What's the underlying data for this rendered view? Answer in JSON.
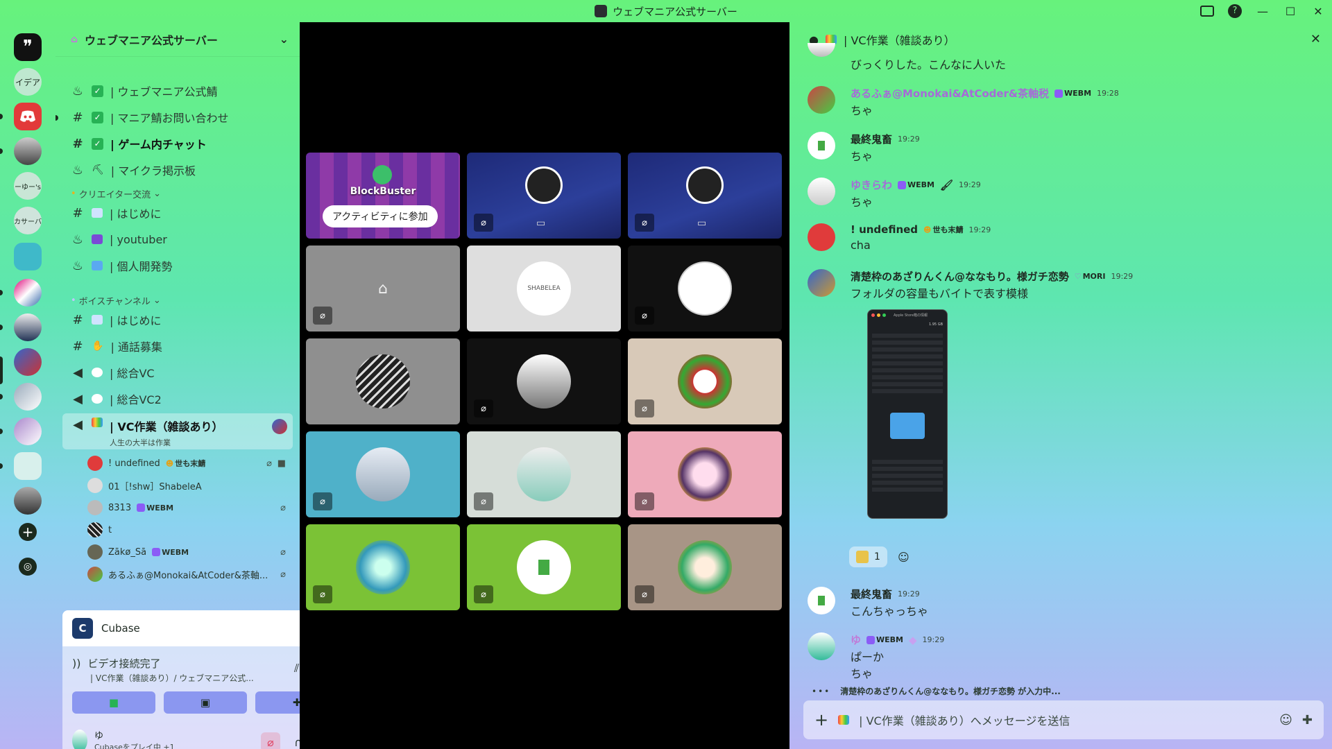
{
  "window": {
    "title": "ウェブマニア公式サーバー"
  },
  "rail": {
    "items": [
      {
        "label": "❞",
        "bg": "#111"
      },
      {
        "label": "イデア",
        "bg": "#bfe8d0"
      },
      {
        "label": "discord",
        "bg": "#e23a3a"
      },
      {
        "label": "",
        "bg": "#9aa"
      },
      {
        "label": "ーゆー's",
        "bg": "#c9e6d6"
      },
      {
        "label": "カサーバ",
        "bg": "#cfe4dc"
      },
      {
        "label": "",
        "bg": "#3fb9c9"
      },
      {
        "label": "",
        "bg": "#d07"
      },
      {
        "label": "",
        "bg": "#36a"
      },
      {
        "label": "",
        "bg": "#55c"
      },
      {
        "label": "",
        "bg": "#7a8"
      },
      {
        "label": "",
        "bg": "#a8b"
      },
      {
        "label": "",
        "bg": "#cfe"
      },
      {
        "label": "",
        "bg": "#333"
      }
    ]
  },
  "sidebar": {
    "server_name": "ウェブマニア公式サーバー",
    "channels": [
      {
        "sym": "♨",
        "label": "| ウェブマニア公式鯖"
      },
      {
        "sym": "#",
        "label": "| マニア鯖お問い合わせ"
      },
      {
        "sym": "#",
        "label": "| ゲーム内チャット"
      },
      {
        "sym": "♨",
        "label": "| マイクラ掲示板"
      }
    ],
    "cat_creator": "クリエイター交流",
    "creator_channels": [
      {
        "sym": "#",
        "label": "| はじめに"
      },
      {
        "sym": "♨",
        "label": "| youtuber"
      },
      {
        "sym": "♨",
        "label": "| 個人開発勢"
      }
    ],
    "cat_voice": "ボイスチャンネル",
    "voice_channels": [
      {
        "sym": "#",
        "label": "| はじめに"
      },
      {
        "sym": "#",
        "label": "| 通話募集"
      },
      {
        "sym": "🔊",
        "label": "| 総合VC"
      },
      {
        "sym": "🔊",
        "label": "| 総合VC2"
      }
    ],
    "active_vc": {
      "label": "| VC作業（雑談あり）",
      "status": "人生の大半は作業"
    },
    "members": [
      {
        "name": "! undefined",
        "tag": "世も末鯖",
        "color": "#e03b3b"
      },
      {
        "name": "01［!shw］ShabeleA",
        "tag": "",
        "color": "#ddd"
      },
      {
        "name": "8313",
        "tag": "WEBM",
        "color": "#bbb"
      },
      {
        "name": "t",
        "tag": "",
        "color": "#222"
      },
      {
        "name": "Zākø_Sā",
        "tag": "WEBM",
        "color": "#665"
      },
      {
        "name": "あるふぁ@Monokai&AtCoder&茶軸...",
        "tag": "",
        "color": "#c44"
      }
    ]
  },
  "panel": {
    "app_name": "Cubase",
    "conn_title": "ビデオ接続完了",
    "conn_sub": "| VC作業（雑談あり）/ ウェブマニア公式...",
    "user_name": "ゆ",
    "user_status": "Cubaseをプレイ中 +1"
  },
  "stage": {
    "activity_title": "BlockBuster",
    "activity_join": "アクティビティに参加",
    "shabelea_text": "SHABELEA"
  },
  "chat": {
    "channel": "| VC作業（雑談あり）",
    "messages": [
      {
        "author": "",
        "tag": "",
        "time": "",
        "text": "びっくりした。こんなに人いた"
      },
      {
        "author": "あるふぁ@Monokai&AtCoder&茶軸税",
        "tag": "WEBM",
        "time": "19:28",
        "text": "ちゃ"
      },
      {
        "author": "最終鬼畜",
        "tag": "",
        "time": "19:29",
        "text": "ちゃ"
      },
      {
        "author": "ゆきらわ",
        "tag": "WEBM",
        "time": "19:29",
        "text": "ちゃ"
      },
      {
        "author": "! undefined",
        "tag": "世も末鯖",
        "time": "19:29",
        "text": "cha"
      },
      {
        "author": "清楚枠のあざりんくん@ななもり。様ガチ恋勢",
        "tag": "MORI",
        "time": "19:29",
        "text": "フォルダの容量もバイトで表す模様"
      },
      {
        "author": "最終鬼畜",
        "tag": "",
        "time": "19:29",
        "text": "こんちゃっちゃ"
      },
      {
        "author": "ゆ",
        "tag": "WEBM",
        "time": "19:29",
        "text": "ぱーか",
        "text2": "ちゃ"
      }
    ],
    "reaction_count": "1",
    "typing": "清楚枠のあざりんくん@ななもり。様ガチ恋勢 が入力中...",
    "composer_placeholder": "| VC作業（雑談あり）へメッセージを送信",
    "attachment_title": "Apple Store箱の情報",
    "attachment_size": "1.95 GB"
  }
}
